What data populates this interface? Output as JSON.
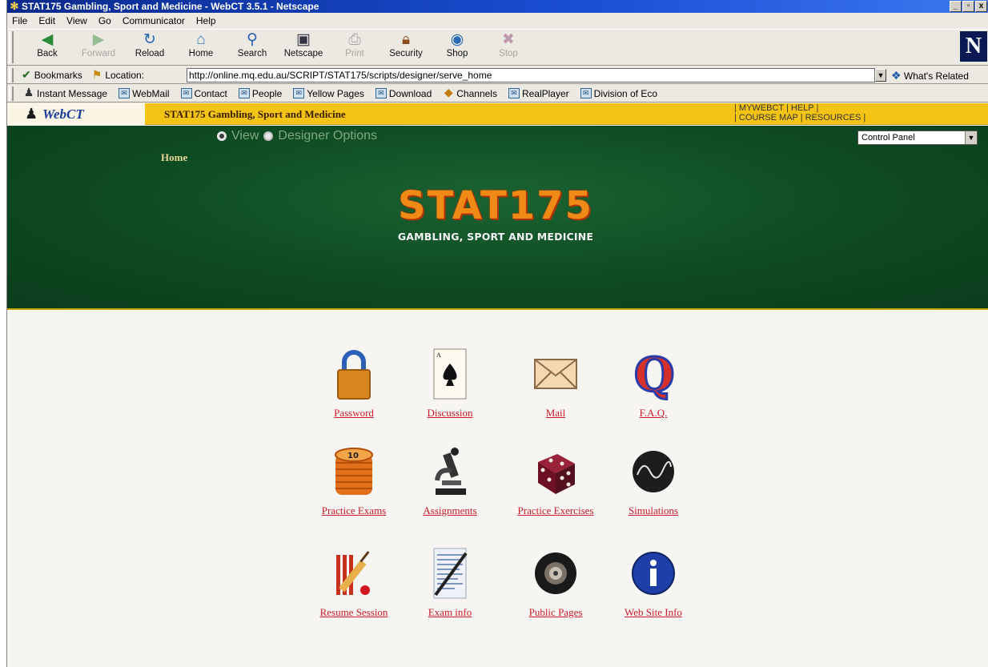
{
  "window": {
    "title": "STAT175 Gambling, Sport and Medicine - WebCT 3.5.1 - Netscape",
    "buttons": [
      "_",
      "▫",
      "x"
    ]
  },
  "menu": [
    "File",
    "Edit",
    "View",
    "Go",
    "Communicator",
    "Help"
  ],
  "toolbar": {
    "buttons": [
      {
        "label": "Back",
        "icon": "back-icon",
        "enabled": true
      },
      {
        "label": "Forward",
        "icon": "forward-icon",
        "enabled": false
      },
      {
        "label": "Reload",
        "icon": "reload-icon",
        "enabled": true
      },
      {
        "label": "Home",
        "icon": "home-icon",
        "enabled": true
      },
      {
        "label": "Search",
        "icon": "search-icon",
        "enabled": true
      },
      {
        "label": "Netscape",
        "icon": "netscape-icon",
        "enabled": true
      },
      {
        "label": "Print",
        "icon": "print-icon",
        "enabled": false
      },
      {
        "label": "Security",
        "icon": "security-icon",
        "enabled": true
      },
      {
        "label": "Shop",
        "icon": "shop-icon",
        "enabled": true
      },
      {
        "label": "Stop",
        "icon": "stop-icon",
        "enabled": false
      }
    ]
  },
  "location": {
    "bookmarks_label": "Bookmarks",
    "location_label": "Location:",
    "url": "http://online.mq.edu.au/SCRIPT/STAT175/scripts/designer/serve_home",
    "related_label": "What's Related"
  },
  "personal_toolbar": [
    "Instant Message",
    "WebMail",
    "Contact",
    "People",
    "Yellow Pages",
    "Download",
    "Channels",
    "RealPlayer",
    "Division of Eco"
  ],
  "webct": {
    "logo_text": "WebCT",
    "course_title": "STAT175 Gambling, Sport and Medicine",
    "top_links_line1": "| MYWEBCT | HELP |",
    "top_links_line2": "| COURSE MAP | RESOURCES |",
    "view_label": "View",
    "designer_label": "Designer Options",
    "control_panel": "Control Panel",
    "home_crumb": "Home",
    "banner_title": "STAT175",
    "banner_subtitle": "GAMBLING, SPORT AND MEDICINE"
  },
  "tools": [
    {
      "label": "Password",
      "icon": "padlock-icon"
    },
    {
      "label": "Discussion",
      "icon": "ace-of-spades-icon"
    },
    {
      "label": "Mail",
      "icon": "envelope-icon"
    },
    {
      "label": "F.A.Q.",
      "icon": "faq-q-icon"
    },
    {
      "label": "Practice Exams",
      "icon": "chip-stack-icon"
    },
    {
      "label": "Assignments",
      "icon": "microscope-icon"
    },
    {
      "label": "Practice Exercises",
      "icon": "dice-icon"
    },
    {
      "label": "Simulations",
      "icon": "wave-ball-icon"
    },
    {
      "label": "Resume Session",
      "icon": "cricket-icon"
    },
    {
      "label": "Exam info",
      "icon": "exam-paper-icon"
    },
    {
      "label": "Public Pages",
      "icon": "roulette-icon"
    },
    {
      "label": "Web Site Info",
      "icon": "info-icon"
    }
  ],
  "colors": {
    "banner_green": "#0e4a22",
    "gold_bar": "#f3c316",
    "link_red": "#c81a2a",
    "title_orange": "#f08a16"
  }
}
